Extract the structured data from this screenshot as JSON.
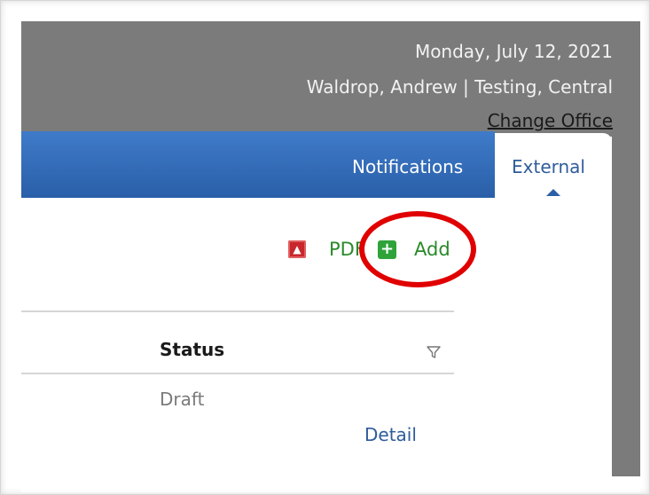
{
  "header": {
    "date": "Monday, July 12, 2021",
    "user_line": "Waldrop, Andrew | Testing, Central",
    "change_office_label": "Change Office"
  },
  "nav": {
    "notifications_label": "Notifications",
    "external_tab_label": "External"
  },
  "toolbar": {
    "pdf_label": "PDF",
    "add_label": "Add",
    "add_symbol": "+"
  },
  "table": {
    "columns": [
      "Status"
    ],
    "rows": [
      {
        "status": "Draft",
        "action_label": "Detail"
      }
    ]
  },
  "colors": {
    "topbar_gray": "#7b7b7b",
    "nav_blue": "#2a5fa8",
    "link_green": "#2a8a2a",
    "highlight_red": "#e00000"
  }
}
